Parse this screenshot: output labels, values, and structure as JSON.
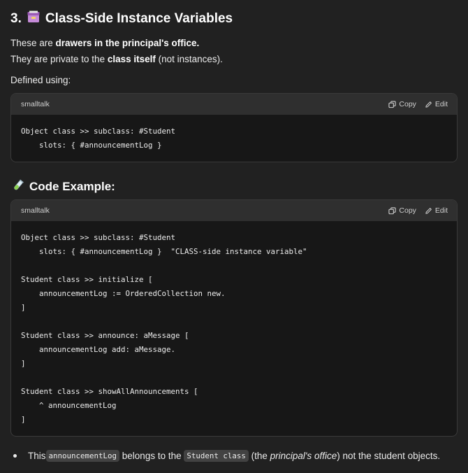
{
  "section": {
    "number": "3.",
    "title": "Class-Side Instance Variables",
    "line1_pre": "These are ",
    "line1_bold": "drawers in the principal's office.",
    "line2_pre": "They are private to the ",
    "line2_bold": "class itself",
    "line2_post": " (not instances).",
    "defined_label": "Defined using:"
  },
  "code_block_1": {
    "language": "smalltalk",
    "copy_label": "Copy",
    "edit_label": "Edit",
    "code": "Object class >> subclass: #Student\n    slots: { #announcementLog }"
  },
  "example": {
    "title": "Code Example:"
  },
  "code_block_2": {
    "language": "smalltalk",
    "copy_label": "Copy",
    "edit_label": "Edit",
    "code": "Object class >> subclass: #Student\n    slots: { #announcementLog }  \"CLASS-side instance variable\"\n\nStudent class >> initialize [\n    announcementLog := OrderedCollection new.\n]\n\nStudent class >> announce: aMessage [\n    announcementLog add: aMessage.\n]\n\nStudent class >> showAllAnnouncements [\n    ^ announcementLog\n]"
  },
  "bullet": {
    "pre": "This ",
    "code1": "announcementLog",
    "mid": " belongs to the ",
    "code2": "Student class",
    "paren_open": " (the ",
    "italic": "principal's office",
    "post": ") not the student objects."
  },
  "colors": {
    "background": "#212121",
    "code_bg": "#171717",
    "code_header_bg": "#2f2f2f"
  }
}
